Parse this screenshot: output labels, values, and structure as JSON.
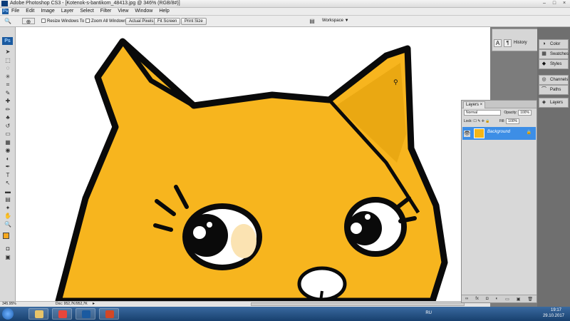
{
  "window": {
    "title": "Adobe Photoshop CS3 - [Kotenok-s-bantikom_48413.jpg @ 346% (RGB/8#)]",
    "controls": [
      "–",
      "□",
      "×"
    ]
  },
  "menu": [
    "File",
    "Edit",
    "Image",
    "Layer",
    "Select",
    "Filter",
    "View",
    "Window",
    "Help"
  ],
  "options_bar": {
    "resize_windows": "Resize Windows To Fit",
    "zoom_all": "Zoom All Windows",
    "actual_pixels": "Actual Pixels",
    "fit_screen": "Fit Screen",
    "print_size": "Print Size",
    "workspace": "Workspace ▼"
  },
  "tools": {
    "logo": "Ps",
    "icons": [
      "move-icon",
      "marquee-icon",
      "lasso-icon",
      "magic-wand-icon",
      "crop-icon",
      "eyedropper-icon",
      "healing-icon",
      "brush-icon",
      "stamp-icon",
      "history-brush-icon",
      "eraser-icon",
      "gradient-icon",
      "blur-icon",
      "dodge-icon",
      "pen-icon",
      "type-icon",
      "path-select-icon",
      "shape-icon",
      "notes-icon",
      "sampler-icon",
      "hand-icon",
      "zoom-icon"
    ],
    "glyphs": [
      "➤",
      "⬚",
      "◌",
      "✳",
      "⌗",
      "✎",
      "✚",
      "✏",
      "♣",
      "↺",
      "▭",
      "▦",
      "◉",
      "◐",
      "✒",
      "T",
      "↖",
      "▬",
      "▤",
      "✦",
      "✋",
      "🔍"
    ],
    "foreground_color": "#f7a81e",
    "background_color": "#ffffff"
  },
  "status": {
    "zoom": "345.95%",
    "doc": "Doc: 952,7K/952,7K"
  },
  "docks": {
    "top_panel": [
      "A",
      "¶",
      "History"
    ],
    "items": [
      {
        "label": "Color",
        "icon": "color-icon",
        "glyph": "◑"
      },
      {
        "label": "Swatches",
        "icon": "swatches-icon",
        "glyph": "▦"
      },
      {
        "label": "Styles",
        "icon": "styles-icon",
        "glyph": "◆"
      },
      {
        "label": "Channels",
        "icon": "channels-icon",
        "glyph": "◎"
      },
      {
        "label": "Paths",
        "icon": "paths-icon",
        "glyph": "⌒"
      },
      {
        "label": "Layers",
        "icon": "layers-icon",
        "glyph": "◈"
      }
    ]
  },
  "layers_panel": {
    "tab": "Layers ×",
    "blend_mode": "Normal",
    "opacity_label": "Opacity:",
    "opacity_value": "100%",
    "lock_label": "Lock:",
    "fill_label": "Fill:",
    "fill_value": "100%",
    "layer_name": "Background",
    "footer_icons": [
      "link-icon",
      "fx-icon",
      "mask-icon",
      "adjustment-icon",
      "folder-icon",
      "new-layer-icon",
      "trash-icon"
    ],
    "footer_glyphs": [
      "∞",
      "fx",
      "◘",
      "◐",
      "▭",
      "▣",
      "🗑"
    ]
  },
  "taskbar": {
    "apps": [
      "explorer-icon",
      "chrome-icon",
      "photoshop-icon",
      "powerpoint-icon"
    ],
    "app_colors": [
      "#e8c469",
      "#e9463b",
      "#1a5aa0",
      "#d24726"
    ],
    "lang": "RU",
    "time": "19:17",
    "date": "29.10.2017"
  },
  "colors": {
    "cat_fill": "#f7b51e",
    "cat_shade": "#eaa812",
    "outline": "#0a0a0a",
    "selection_blue": "#3d8ee6"
  }
}
